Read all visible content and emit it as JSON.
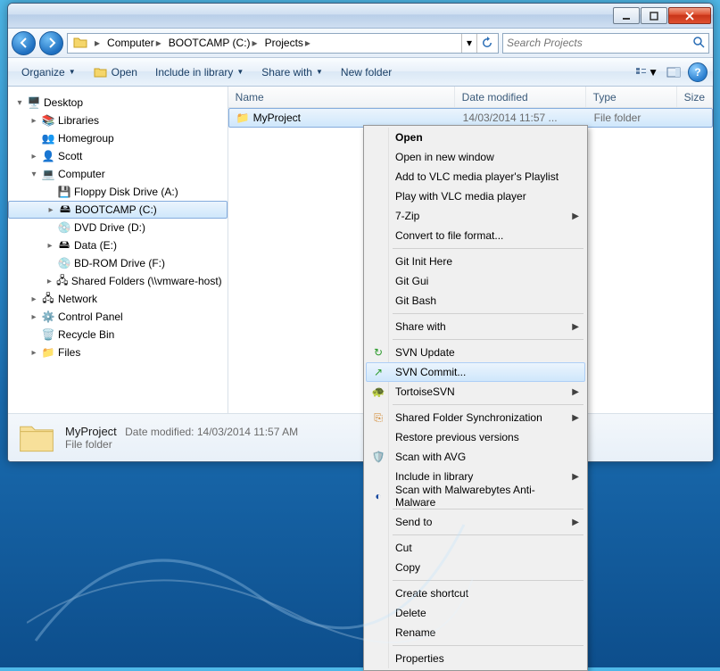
{
  "titlebar": {},
  "nav": {
    "crumbs": [
      "Computer",
      "BOOTCAMP (C:)",
      "Projects"
    ],
    "search_placeholder": "Search Projects"
  },
  "toolbar": {
    "organize": "Organize",
    "open": "Open",
    "include": "Include in library",
    "share": "Share with",
    "newfolder": "New folder"
  },
  "tree": {
    "desktop": "Desktop",
    "libraries": "Libraries",
    "homegroup": "Homegroup",
    "scott": "Scott",
    "computer": "Computer",
    "floppy": "Floppy Disk Drive (A:)",
    "bootcamp": "BOOTCAMP (C:)",
    "dvd": "DVD Drive (D:)",
    "data": "Data (E:)",
    "bdrom": "BD-ROM Drive (F:)",
    "shared": "Shared Folders (\\\\vmware-host)",
    "network": "Network",
    "cpanel": "Control Panel",
    "recycle": "Recycle Bin",
    "files": "Files"
  },
  "columns": {
    "name": "Name",
    "date": "Date modified",
    "type": "Type",
    "size": "Size"
  },
  "rows": [
    {
      "name": "MyProject",
      "date": "14/03/2014 11:57 ...",
      "type": "File folder"
    }
  ],
  "details": {
    "name": "MyProject",
    "date_label": "Date modified:",
    "date": "14/03/2014 11:57 AM",
    "type": "File folder"
  },
  "context_menu": {
    "open": "Open",
    "open_new": "Open in new window",
    "vlc_add": "Add to VLC media player's Playlist",
    "vlc_play": "Play with VLC media player",
    "sevenzip": "7-Zip",
    "convert": "Convert to file format...",
    "git_init": "Git Init Here",
    "git_gui": "Git Gui",
    "git_bash": "Git Bash",
    "share": "Share with",
    "svn_update": "SVN Update",
    "svn_commit": "SVN Commit...",
    "tortoise": "TortoiseSVN",
    "shared_sync": "Shared Folder Synchronization",
    "restore": "Restore previous versions",
    "avg": "Scan with AVG",
    "include_lib": "Include in library",
    "mbam": "Scan with Malwarebytes Anti-Malware",
    "sendto": "Send to",
    "cut": "Cut",
    "copy": "Copy",
    "shortcut": "Create shortcut",
    "delete": "Delete",
    "rename": "Rename",
    "properties": "Properties"
  }
}
